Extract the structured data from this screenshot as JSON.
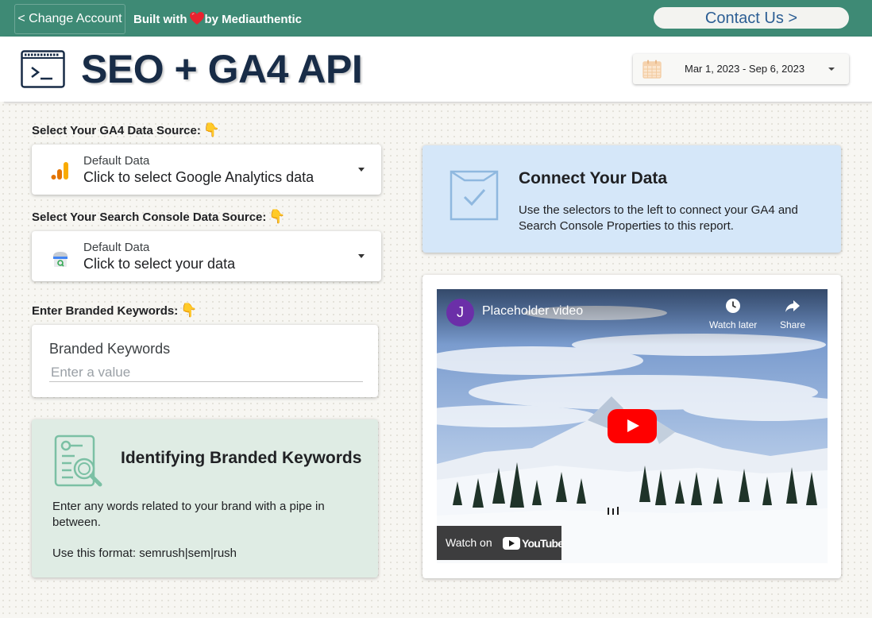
{
  "topbar": {
    "change_account": "< Change Account",
    "built_with_prefix": "Built with",
    "built_with_suffix": "by Mediauthentic",
    "contact": "Contact Us >",
    "heart_icon": "heart-emoji"
  },
  "header": {
    "title": "SEO + GA4 API",
    "date_range": "Mar 1, 2023 - Sep 6, 2023"
  },
  "ga4": {
    "label": "Select Your GA4 Data Source:",
    "label_emoji": "👇",
    "sub": "Default Data",
    "main": "Click to select Google Analytics data",
    "icon": "google-analytics-icon"
  },
  "gsc": {
    "label": "Select Your Search Console Data Source:",
    "label_emoji": "👇",
    "sub": "Default Data",
    "main": "Click to select your data",
    "icon": "search-console-icon"
  },
  "keywords": {
    "label": "Enter Branded Keywords:",
    "label_emoji": "👇",
    "field_title": "Branded Keywords",
    "placeholder": "Enter a value",
    "value": ""
  },
  "info": {
    "title": "Identifying Branded Keywords",
    "text": "Enter any words related to your brand with a pipe in between.",
    "format": "Use this format:  semrush|sem|rush"
  },
  "connect": {
    "title": "Connect Your Data",
    "text": "Use the selectors to the left to connect your GA4 and Search Console Properties to this report."
  },
  "video": {
    "avatar_letter": "J",
    "title": "Placeholder video",
    "watch_later": "Watch later",
    "share": "Share",
    "watch_on": "Watch on",
    "youtube": "YouTube"
  },
  "colors": {
    "topbar": "#3e8a75",
    "title": "#182c47",
    "contact_text": "#2c5e94",
    "info_card": "#dfece4",
    "connect_card": "#d5e7f9",
    "play": "#ff0000"
  }
}
